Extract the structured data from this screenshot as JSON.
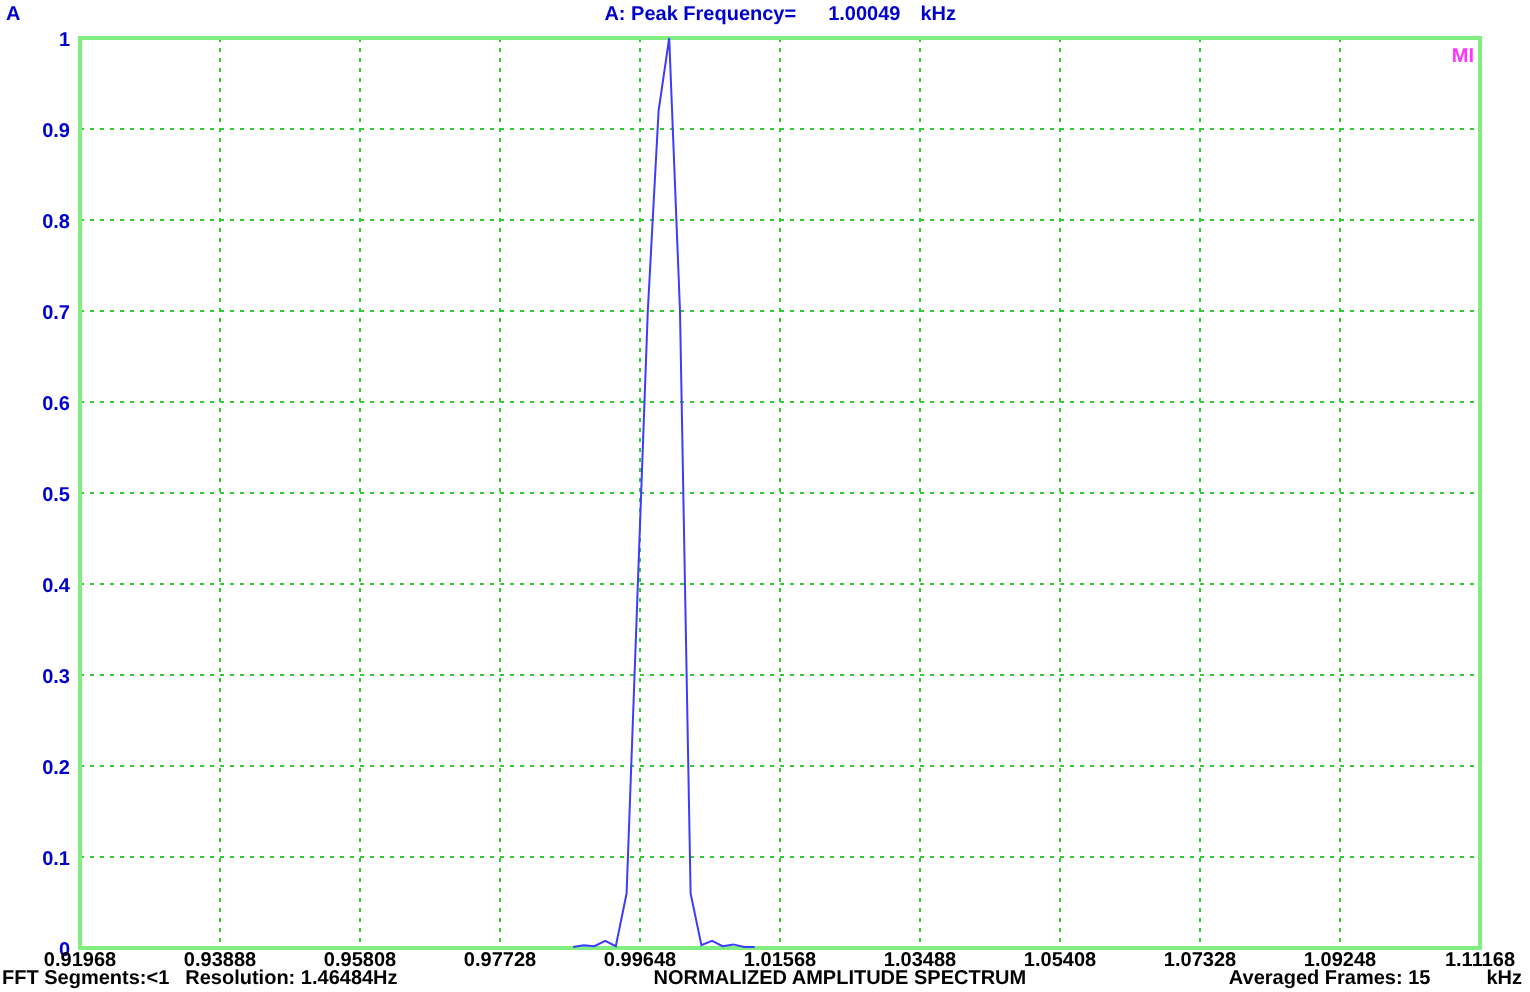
{
  "header": {
    "title": "A: Peak Frequency=",
    "value": "1.00049",
    "unit": "kHz"
  },
  "plot": {
    "marker": "MI",
    "chart_data": {
      "type": "line",
      "grid": true,
      "xlabel": "kHz",
      "xlim": [
        0.91968,
        1.11168
      ],
      "ylim": [
        0,
        1
      ],
      "xticks": [
        0.91968,
        0.93888,
        0.95808,
        0.97728,
        0.99648,
        1.01568,
        1.03488,
        1.05408,
        1.07328,
        1.09248,
        1.11168
      ],
      "yticks": [
        0,
        0.1,
        0.2,
        0.3,
        0.4,
        0.5,
        0.6,
        0.7,
        0.8,
        0.9,
        1
      ],
      "x": [
        0.98731,
        0.98878,
        0.99024,
        0.99171,
        0.99317,
        0.99463,
        0.9961,
        0.99756,
        0.99903,
        1.00049,
        1.00196,
        1.00342,
        1.00489,
        1.00635,
        1.00782,
        1.00928,
        1.01075,
        1.01221
      ],
      "series": [
        {
          "name": "A",
          "color": "#3c3cff",
          "values": [
            0.001,
            0.003,
            0.002,
            0.008,
            0.002,
            0.06,
            0.38,
            0.7,
            0.92,
            1,
            0.7,
            0.06,
            0.003,
            0.008,
            0.002,
            0.004,
            0.001,
            0.001
          ]
        }
      ]
    }
  },
  "footer": {
    "segments": "FFT Segments:<1",
    "resolution": "Resolution: 1.46484Hz",
    "title": "NORMALIZED AMPLITUDE SPECTRUM",
    "frames": "Averaged Frames: 15"
  }
}
